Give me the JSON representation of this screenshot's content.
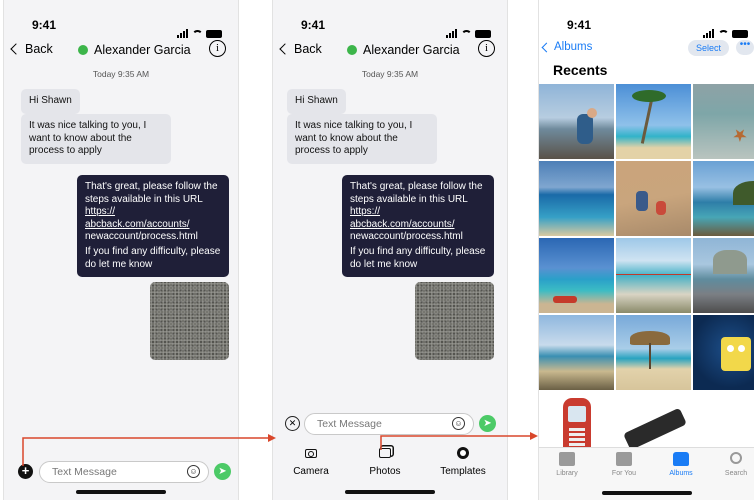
{
  "status": {
    "time": "9:41"
  },
  "chat": {
    "back_label": "Back",
    "contact_name": "Alexander Garcia",
    "info_icon": "i",
    "timestamp": "Today 9:35 AM",
    "messages": {
      "m1": "Hi Shawn",
      "m2": "It was nice talking to you, I want to know about the process to apply",
      "m3_text": "That's great, please follow the steps available in this URL",
      "m3_url": "https:// abcback.com/accounts/ newaccount/process.html",
      "m4": "If you find any difficulty, please do let me know"
    },
    "input_placeholder": "Text Message"
  },
  "attach_tray": {
    "camera": "Camera",
    "photos": "Photos",
    "templates": "Templates"
  },
  "photos_app": {
    "back_label": "Albums",
    "select_label": "Select",
    "more_label": "•••",
    "title": "Recents",
    "tabs": {
      "library": "Library",
      "for_you": "For You",
      "albums": "Albums",
      "search": "Search"
    }
  },
  "colors": {
    "accent_blue": "#1a7cf5",
    "send_green": "#4cca67",
    "bubble_dark": "#1f1f38",
    "arrow_red": "#d9472b"
  }
}
